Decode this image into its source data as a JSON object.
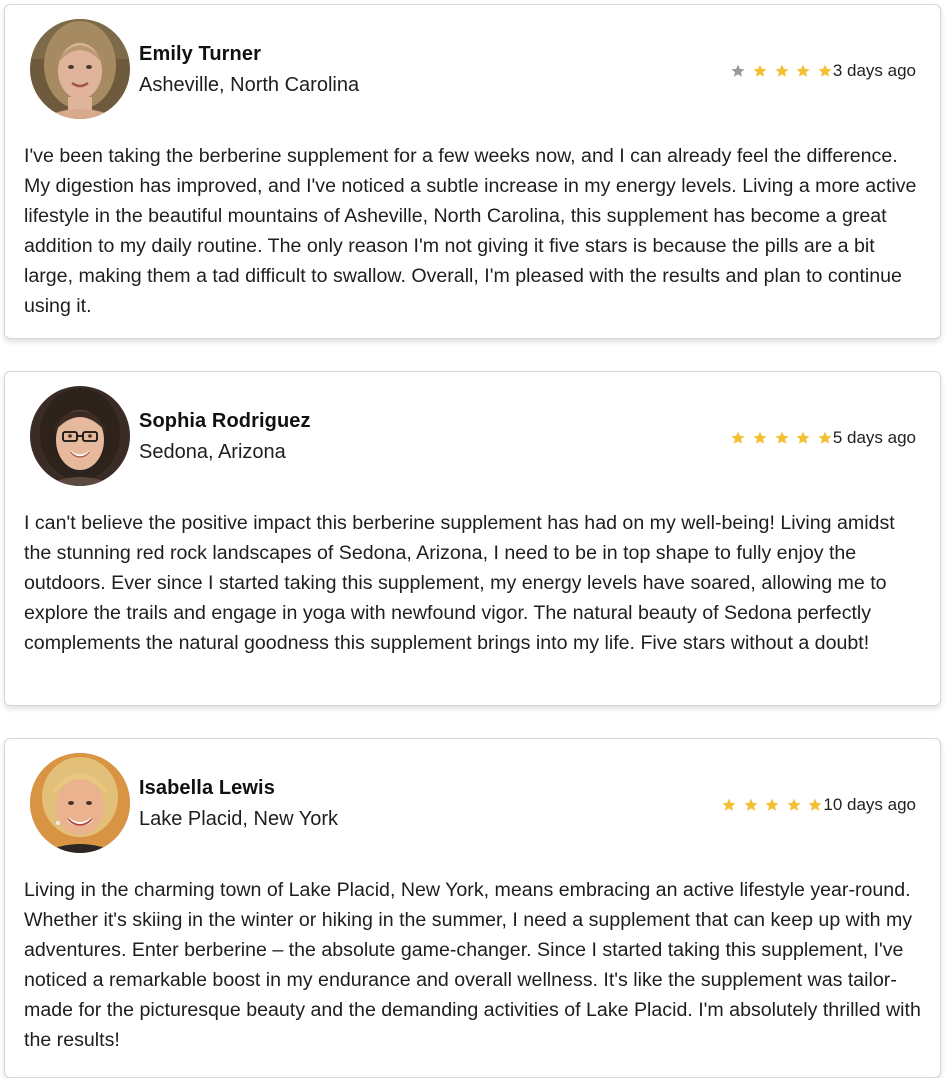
{
  "colors": {
    "star_filled": "#f2c032",
    "star_empty": "#9a9a9a",
    "card_border": "#d6d6d6",
    "text": "#1e1e1e"
  },
  "reviews": [
    {
      "name": "Emily Turner",
      "location": "Asheville, North Carolina",
      "rating": 4,
      "rating_max": 5,
      "date": "3 days ago",
      "avatar_icon": "avatar-emily-turner",
      "text": "I've been taking the berberine supplement for a few weeks now, and I can already feel the difference. My digestion has improved, and I've noticed a subtle increase in my energy levels. Living a more active lifestyle in the beautiful mountains of Asheville, North Carolina, this supplement has become a great addition to my daily routine. The only reason I'm not giving it five stars is because the pills are a bit large, making them a tad difficult to swallow. Overall, I'm pleased with the results and plan to continue using it."
    },
    {
      "name": "Sophia Rodriguez",
      "location": "Sedona, Arizona",
      "rating": 5,
      "rating_max": 5,
      "date": "5 days ago",
      "avatar_icon": "avatar-sophia-rodriguez",
      "text": "I can't believe the positive impact this berberine supplement has had on my well-being! Living amidst the stunning red rock landscapes of Sedona, Arizona, I need to be in top shape to fully enjoy the outdoors. Ever since I started taking this supplement, my energy levels have soared, allowing me to explore the trails and engage in yoga with newfound vigor. The natural beauty of Sedona perfectly complements the natural goodness this supplement brings into my life. Five stars without a doubt!"
    },
    {
      "name": "Isabella Lewis",
      "location": "Lake Placid, New York",
      "rating": 5,
      "rating_max": 5,
      "date": "10 days ago",
      "avatar_icon": "avatar-isabella-lewis",
      "text": "Living in the charming town of Lake Placid, New York, means embracing an active lifestyle year-round. Whether it's skiing in the winter or hiking in the summer, I need a supplement that can keep up with my adventures. Enter berberine – the absolute game-changer. Since I started taking this supplement, I've noticed a remarkable boost in my endurance and overall wellness. It's like the supplement was tailor-made for the picturesque beauty and the demanding activities of Lake Placid. I'm absolutely thrilled with the results!"
    }
  ]
}
